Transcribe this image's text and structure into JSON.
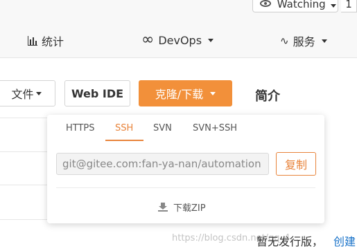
{
  "header": {
    "watch_label": "Watching",
    "watch_count": "1"
  },
  "nav": {
    "stats": "统计",
    "devops": "DevOps",
    "service": "服务"
  },
  "toolbar": {
    "file_label": "文件",
    "webide_label": "Web IDE",
    "clone_label": "克隆/下载",
    "intro_label": "简介"
  },
  "clone_dropdown": {
    "tabs": [
      "HTTPS",
      "SSH",
      "SVN",
      "SVN+SSH"
    ],
    "active_tab": "SSH",
    "url_value": "git@gitee.com:fan-ya-nan/automation",
    "copy_label": "复制",
    "download_label": "下载ZIP"
  },
  "sidebar": {
    "no_release": "暂无发行版，",
    "create_link": "创建"
  },
  "watermark": "https://blog.csdn.net/qq_4..."
}
